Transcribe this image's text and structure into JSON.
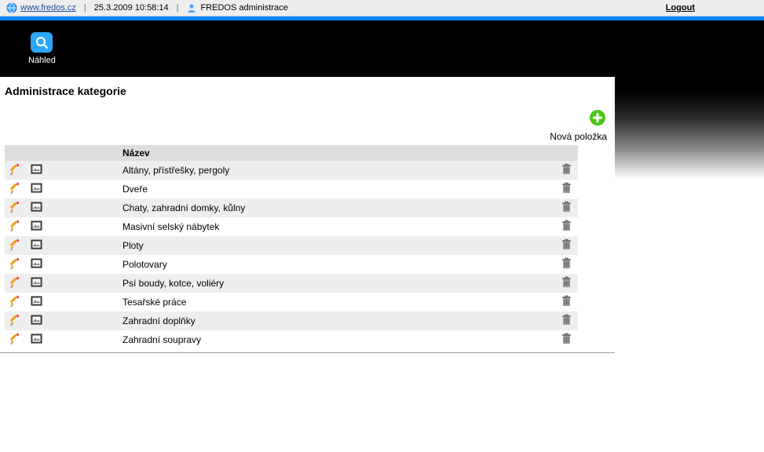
{
  "top_bar": {
    "site_link": "www.fredos.cz",
    "datetime": "25.3.2009 10:58:14",
    "admin_label": "FREDOS administrace",
    "logout_label": "Logout"
  },
  "toolbar": {
    "preview_label": "Náhled"
  },
  "page": {
    "title": "Administrace kategorie",
    "new_item_label": "Nová položka",
    "column_name": "Název"
  },
  "categories": [
    {
      "name": "Altány, přístřešky, pergoly"
    },
    {
      "name": "Dveře"
    },
    {
      "name": "Chaty, zahradní domky, kůlny"
    },
    {
      "name": "Masivní selský nábytek"
    },
    {
      "name": "Ploty"
    },
    {
      "name": "Polotovary"
    },
    {
      "name": "Psí boudy, kotce, voliéry"
    },
    {
      "name": "Tesařské práce"
    },
    {
      "name": "Zahradní doplňky"
    },
    {
      "name": "Zahradní soupravy"
    }
  ]
}
